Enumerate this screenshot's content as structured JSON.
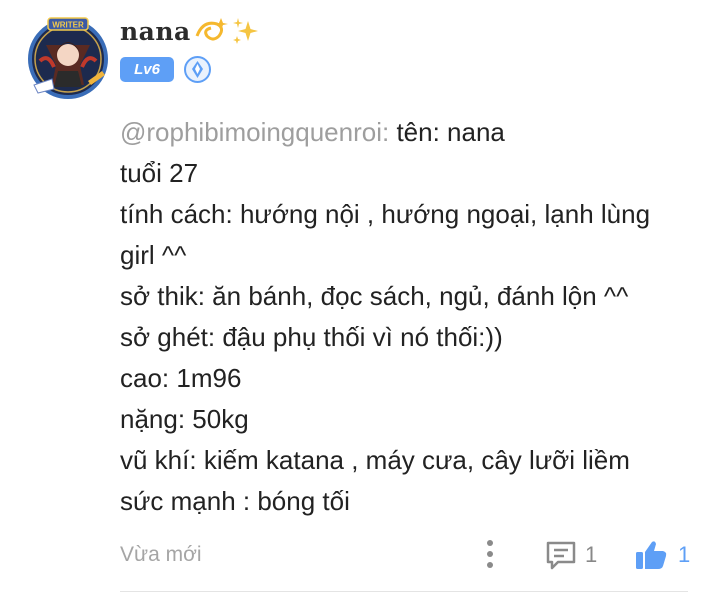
{
  "user": {
    "name": "nana",
    "name_decoration_icons": [
      "dizzy-icon",
      "sparkles-icon"
    ],
    "avatar_badge_text": "WRITER",
    "level": "Lv6",
    "rank_icon": "diamond-rank-icon"
  },
  "comment": {
    "mention": "@rophibimoingquenroi:",
    "lines": [
      "tên: nana",
      "tuổi 27",
      "tính cách: hướng nội , hướng ngoại, lạnh lùng",
      "girl ^^",
      "sở thik: ăn bánh, đọc sách, ngủ, đánh lộn ^^",
      "sở ghét: đậu phụ thối vì nó thối:))",
      "cao: 1m96",
      "nặng: 50kg",
      "vũ khí: kiếm katana , máy cưa, cây lưỡi liềm",
      "sức mạnh : bóng tối"
    ]
  },
  "footer": {
    "timestamp": "Vừa mới",
    "more_icon": "more-vertical-icon",
    "reply_icon": "comment-icon",
    "reply_count": "1",
    "like_icon": "thumbs-up-icon",
    "like_count": "1"
  },
  "colors": {
    "accent": "#5e9ff6",
    "text": "#222222",
    "muted": "#9e9e9e",
    "gold": "#f2c94c"
  }
}
